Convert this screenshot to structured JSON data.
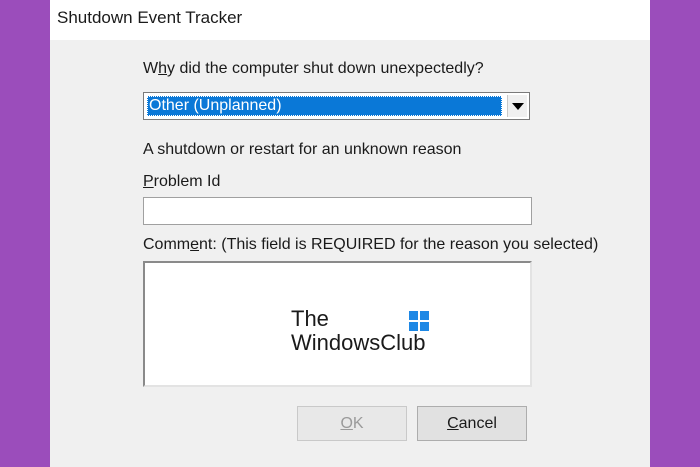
{
  "window": {
    "title": "Shutdown Event Tracker"
  },
  "reason": {
    "prompt_pre": "W",
    "prompt_ul": "h",
    "prompt_post": "y did the computer shut down unexpectedly?",
    "selected": "Other (Unplanned)",
    "description": "A shutdown or restart for an unknown reason"
  },
  "problem": {
    "label_pre": "",
    "label_ul": "P",
    "label_post": "roblem Id",
    "value": ""
  },
  "comment": {
    "label_pre": "Comm",
    "label_ul": "e",
    "label_post": "nt: (This field is REQUIRED for the reason you selected)",
    "value": ""
  },
  "watermark": {
    "line1": "The",
    "line2": "WindowsClub"
  },
  "buttons": {
    "ok_pre": "",
    "ok_ul": "O",
    "ok_post": "K",
    "cancel_pre": "",
    "cancel_ul": "C",
    "cancel_post": "ancel"
  },
  "colors": {
    "background": "#9b4dbb",
    "selection": "#0a78d7",
    "dialog": "#f0f0f0"
  }
}
